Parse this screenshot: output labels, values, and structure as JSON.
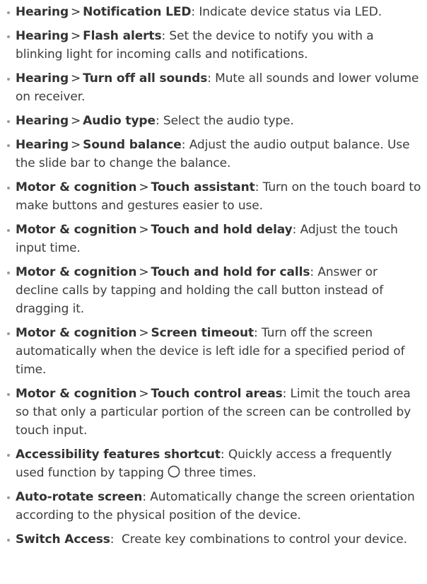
{
  "items": [
    {
      "path1": "Hearing",
      "sep": ">",
      "path2": "Notification LED",
      "colon": ":",
      "desc": " Indicate device status via LED."
    },
    {
      "path1": "Hearing",
      "sep": ">",
      "path2": "Flash alerts",
      "colon": ":",
      "desc": " Set the device to notify you with a blinking light for incoming calls and notifications."
    },
    {
      "path1": "Hearing",
      "sep": ">",
      "path2": "Turn off all sounds",
      "colon": ":",
      "desc": " Mute all sounds and lower volume on receiver."
    },
    {
      "path1": "Hearing",
      "sep": ">",
      "path2": "Audio type",
      "colon": ":",
      "desc": " Select the audio type."
    },
    {
      "path1": "Hearing",
      "sep": ">",
      "path2": "Sound balance",
      "colon": ":",
      "desc": " Adjust the audio output balance. Use the slide bar to change the balance."
    },
    {
      "path1": "Motor & cognition",
      "sep": ">",
      "path2": "Touch assistant",
      "colon": ":",
      "desc": " Turn on the touch board to make buttons and gestures easier to use."
    },
    {
      "path1": "Motor & cognition",
      "sep": ">",
      "path2": "Touch and hold delay",
      "colon": ":",
      "desc": " Adjust the touch input time."
    },
    {
      "path1": "Motor & cognition",
      "sep": ">",
      "path2": "Touch and hold for calls",
      "colon": ":",
      "desc": " Answer or decline  calls by tapping and holding the call button instead of dragging it."
    },
    {
      "path1": "Motor & cognition",
      "sep": ">",
      "path2": "Screen timeout",
      "colon": ":",
      "desc": " Turn off the screen automatically  when the device is left idle for a specified period of time."
    },
    {
      "path1": "Motor & cognition",
      "sep": ">",
      "path2": "Touch control areas",
      "colon": ":",
      "desc": " Limit  the touch area so that only a particular portion of the screen can be controlled by touch input."
    }
  ],
  "shortcut": {
    "title": "Accessibility features shortcut",
    "colon": ":",
    "desc_before": " Quickly access a frequently used function by tapping ",
    "icon": "home-button-circle-icon",
    "desc_after": " three times."
  },
  "autorotate": {
    "title": "Auto-rotate screen",
    "colon": ":",
    "desc": " Automatically change the screen orientation according to the physical position of the device."
  },
  "switch_access": {
    "title": "Switch Access",
    "colon": ":",
    "desc": "  Create key combinations to control your device."
  }
}
